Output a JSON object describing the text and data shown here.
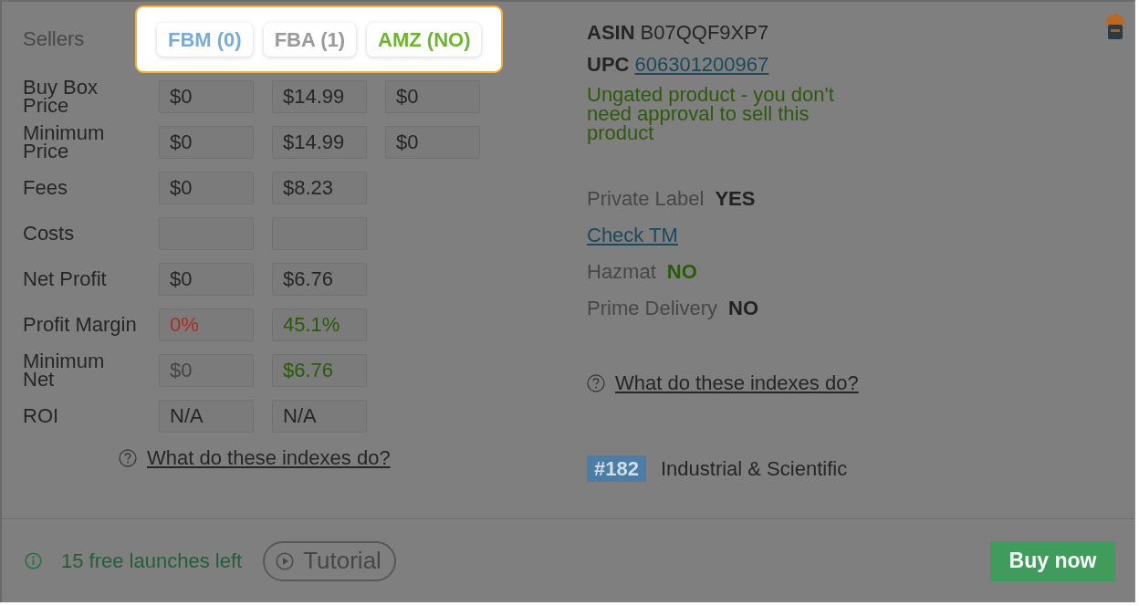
{
  "sellers": {
    "label": "Sellers",
    "tabs": [
      {
        "label": "FBM (0)",
        "color": "#78acd8"
      },
      {
        "label": "FBA (1)",
        "color": "#9a9a9a"
      },
      {
        "label": "AMZ (NO)",
        "color": "#6cb52d"
      }
    ]
  },
  "rows": [
    {
      "label": "Buy Box Price",
      "cells": [
        {
          "kind": "value",
          "value": "$0"
        },
        {
          "kind": "value",
          "value": "$14.99"
        },
        {
          "kind": "value",
          "value": "$0"
        }
      ]
    },
    {
      "label": "Minimum Price",
      "cells": [
        {
          "kind": "value",
          "value": "$0"
        },
        {
          "kind": "value",
          "value": "$14.99"
        },
        {
          "kind": "value",
          "value": "$0"
        }
      ]
    },
    {
      "label": "Fees",
      "cells": [
        {
          "kind": "value",
          "value": "$0"
        },
        {
          "kind": "value",
          "value": "$8.23"
        }
      ]
    },
    {
      "label": "Costs",
      "cells": [
        {
          "kind": "input"
        },
        {
          "kind": "input"
        }
      ]
    },
    {
      "label": "Net Profit",
      "cells": [
        {
          "kind": "value",
          "value": "$0"
        },
        {
          "kind": "value",
          "value": "$6.76"
        }
      ]
    },
    {
      "label": "Profit Margin",
      "cells": [
        {
          "kind": "value",
          "value": "0%",
          "color": "#a8301f"
        },
        {
          "kind": "value",
          "value": "45.1%",
          "color": "#2d5a0a"
        }
      ]
    },
    {
      "label": "Minimum Net",
      "cells": [
        {
          "kind": "value",
          "value": "$0",
          "color": "#464646"
        },
        {
          "kind": "value",
          "value": "$6.76",
          "color": "#2d5a0a"
        }
      ]
    },
    {
      "label": "ROI",
      "cells": [
        {
          "kind": "value",
          "value": "N/A"
        },
        {
          "kind": "value",
          "value": "N/A"
        }
      ]
    }
  ],
  "help_link": "What do these indexes do?",
  "product": {
    "asin": {
      "label": "ASIN",
      "value": "B07QQF9XP7"
    },
    "upc": {
      "label": "UPC",
      "value": "606301200967"
    },
    "ungated_note": "Ungated product - you don't need approval to sell this product",
    "attributes": [
      {
        "kind": "pair",
        "label": "Private Label",
        "value": "YES",
        "color": "#222222"
      },
      {
        "kind": "link",
        "label": "Check TM"
      },
      {
        "kind": "pair",
        "label": "Hazmat",
        "value": "NO",
        "color": "#2b5a08"
      },
      {
        "kind": "pair",
        "label": "Prime Delivery",
        "value": "NO",
        "color": "#222222"
      }
    ],
    "help_link": "What do these indexes do?",
    "rank": {
      "badge": "#182",
      "category": "Industrial & Scientific"
    }
  },
  "footer": {
    "launches": "15 free launches left",
    "tutorial": "Tutorial",
    "buy": "Buy now"
  }
}
